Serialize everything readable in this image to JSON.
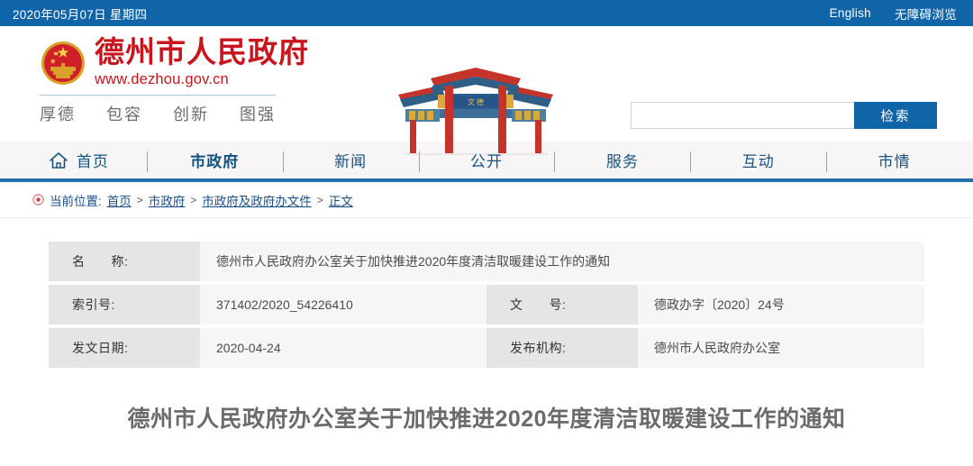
{
  "topbar": {
    "date": "2020年05月07日 星期四",
    "links": [
      {
        "label": "English",
        "name": "english-link"
      },
      {
        "label": "无障碍浏览",
        "name": "accessibility-link"
      }
    ]
  },
  "header": {
    "site_title": "德州市人民政府",
    "site_url": "www.dezhou.gov.cn",
    "slogan": [
      "厚德",
      "包容",
      "创新",
      "图强"
    ],
    "emblem_icon": "national-emblem-icon",
    "archway_icon": "paifang-archway-image",
    "search": {
      "value": "",
      "placeholder": "",
      "button_label": "检索"
    },
    "brand_color": "#c8161d",
    "accent_color": "#1065a8"
  },
  "nav": {
    "items": [
      {
        "label": "首页",
        "icon": "home-icon",
        "active": false
      },
      {
        "label": "市政府",
        "icon": "",
        "active": true
      },
      {
        "label": "新闻",
        "icon": "",
        "active": false
      },
      {
        "label": "公开",
        "icon": "",
        "active": false
      },
      {
        "label": "服务",
        "icon": "",
        "active": false
      },
      {
        "label": "互动",
        "icon": "",
        "active": false
      },
      {
        "label": "市情",
        "icon": "",
        "active": false
      }
    ],
    "underline_color": "#1f6fa8"
  },
  "breadcrumb": {
    "icon": "location-pin-icon",
    "label": "当前位置:",
    "trail": [
      "首页",
      "市政府",
      "市政府及政府办文件",
      "正文"
    ],
    "separator": ">"
  },
  "info_table": {
    "rows": [
      {
        "label1": "名　　称:",
        "value1": "德州市人民政府办公室关于加快推进2020年度清洁取暖建设工作的通知",
        "full_width": true
      },
      {
        "label1": "索引号:",
        "value1": "371402/2020_54226410",
        "label2": "文　　号:",
        "value2": "德政办字〔2020〕24号",
        "full_width": false
      },
      {
        "label1": "发文日期:",
        "value1": "2020-04-24",
        "label2": "发布机构:",
        "value2": "德州市人民政府办公室",
        "full_width": false
      }
    ]
  },
  "document": {
    "title": "德州市人民政府办公室关于加快推进2020年度清洁取暖建设工作的通知"
  }
}
